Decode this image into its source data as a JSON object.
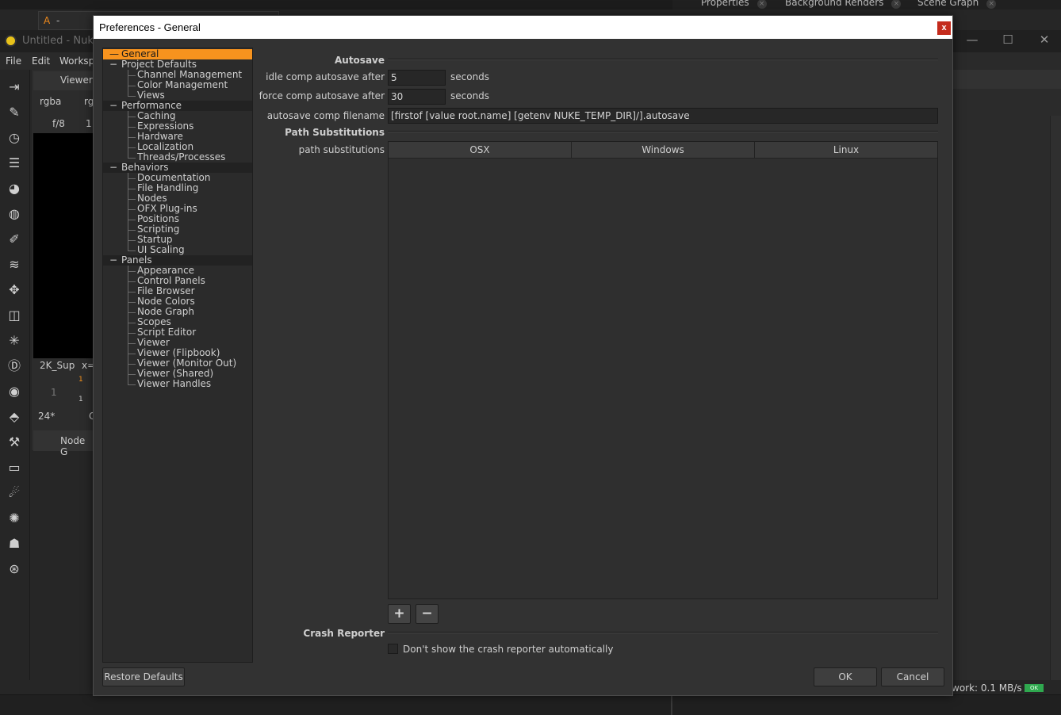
{
  "background": {
    "viewer_tab": {
      "marker": "A",
      "dash": "-"
    },
    "right_tabs": [
      "Properties",
      "Background Renders",
      "Scene Graph"
    ],
    "app_title": "Untitled - Nuke",
    "menu": [
      "File",
      "Edit",
      "Worksp"
    ],
    "viewer": {
      "title": "Viewer",
      "channels": "rgba",
      "channels2": "rg",
      "frame_label": "f/8",
      "frame_number": "1",
      "format": "2K_Sup",
      "coord": "x=",
      "timeline_start": "1",
      "timeline_marker_top": "1",
      "timeline_marker_bottom": "1",
      "fps": "24*",
      "extra": "C"
    },
    "node_graph_tab": "Node G",
    "status": "work: 0.1 MB/s",
    "status_badge": "OK"
  },
  "dialog": {
    "title": "Preferences - General",
    "close_glyph": "x",
    "tree": [
      {
        "label": "General",
        "level": 0,
        "selected": true
      },
      {
        "label": "Project Defaults",
        "level": 0,
        "category": false,
        "expanded": true
      },
      {
        "label": "Channel Management",
        "level": 1
      },
      {
        "label": "Color Management",
        "level": 1
      },
      {
        "label": "Views",
        "level": 1
      },
      {
        "label": "Performance",
        "level": 0,
        "category": true,
        "expanded": true
      },
      {
        "label": "Caching",
        "level": 1
      },
      {
        "label": "Expressions",
        "level": 1
      },
      {
        "label": "Hardware",
        "level": 1
      },
      {
        "label": "Localization",
        "level": 1
      },
      {
        "label": "Threads/Processes",
        "level": 1
      },
      {
        "label": "Behaviors",
        "level": 0,
        "category": true,
        "expanded": true
      },
      {
        "label": "Documentation",
        "level": 1
      },
      {
        "label": "File Handling",
        "level": 1
      },
      {
        "label": "Nodes",
        "level": 1
      },
      {
        "label": "OFX Plug-ins",
        "level": 1
      },
      {
        "label": "Positions",
        "level": 1
      },
      {
        "label": "Scripting",
        "level": 1
      },
      {
        "label": "Startup",
        "level": 1
      },
      {
        "label": "UI Scaling",
        "level": 1
      },
      {
        "label": "Panels",
        "level": 0,
        "category": true,
        "expanded": true
      },
      {
        "label": "Appearance",
        "level": 1
      },
      {
        "label": "Control Panels",
        "level": 1
      },
      {
        "label": "File Browser",
        "level": 1
      },
      {
        "label": "Node Colors",
        "level": 1
      },
      {
        "label": "Node Graph",
        "level": 1
      },
      {
        "label": "Scopes",
        "level": 1
      },
      {
        "label": "Script Editor",
        "level": 1
      },
      {
        "label": "Viewer",
        "level": 1
      },
      {
        "label": "Viewer (Flipbook)",
        "level": 1
      },
      {
        "label": "Viewer (Monitor Out)",
        "level": 1
      },
      {
        "label": "Viewer (Shared)",
        "level": 1
      },
      {
        "label": "Viewer Handles",
        "level": 1
      }
    ],
    "collapse_glyph": "−",
    "autosave": {
      "section": "Autosave",
      "idle_label": "idle comp autosave after",
      "idle_value": "5",
      "force_label": "force comp autosave after",
      "force_value": "30",
      "unit": "seconds",
      "filename_label": "autosave comp filename",
      "filename_value": "[firstof [value root.name] [getenv NUKE_TEMP_DIR]/].autosave"
    },
    "path_subs": {
      "section": "Path Substitutions",
      "label": "path substitutions",
      "columns": [
        "OSX",
        "Windows",
        "Linux"
      ],
      "add_glyph": "+",
      "remove_glyph": "−"
    },
    "crash": {
      "section": "Crash Reporter",
      "checkbox_label": "Don't show the crash reporter automatically",
      "checked": false
    },
    "buttons": {
      "restore": "Restore Defaults",
      "ok": "OK",
      "cancel": "Cancel"
    },
    "colors": {
      "selected_highlight": "#f7931e",
      "close_button": "#c42b1c"
    }
  }
}
